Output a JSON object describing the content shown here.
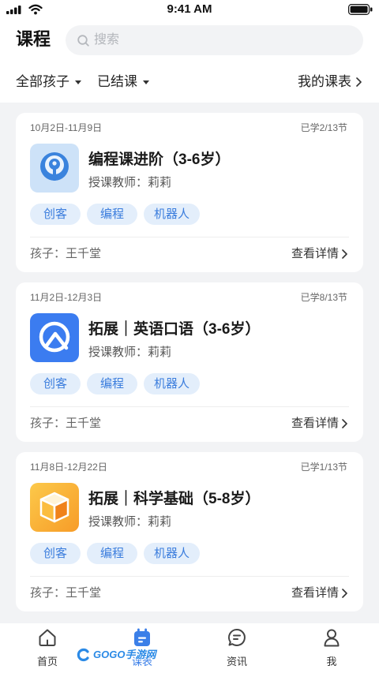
{
  "status_bar": {
    "time": "9:41 AM",
    "icons": [
      "signal-icon",
      "wifi-icon",
      "battery-icon"
    ]
  },
  "header": {
    "title": "课程",
    "search": {
      "placeholder": "搜索",
      "value": ""
    }
  },
  "filters": {
    "child": {
      "label": "全部孩子"
    },
    "status": {
      "label": "已结课"
    },
    "schedule_link": {
      "label": "我的课表"
    }
  },
  "courses": [
    {
      "date_range": "10月2日-11月9日",
      "progress": "已学2/13节",
      "icon": "coding-course-icon",
      "title": "编程课进阶（3-6岁）",
      "teacher": "授课教师：莉莉",
      "tags": [
        "创客",
        "编程",
        "机器人"
      ],
      "child": "孩子：王千堂",
      "detail_label": "查看详情"
    },
    {
      "date_range": "11月2日-12月3日",
      "progress": "已学8/13节",
      "icon": "english-course-icon",
      "title": "拓展｜英语口语（3-6岁）",
      "teacher": "授课教师：莉莉",
      "tags": [
        "创客",
        "编程",
        "机器人"
      ],
      "child": "孩子：王千堂",
      "detail_label": "查看详情"
    },
    {
      "date_range": "11月8日-12月22日",
      "progress": "已学1/13节",
      "icon": "science-course-icon",
      "title": "拓展｜科学基础（5-8岁）",
      "teacher": "授课教师：莉莉",
      "tags": [
        "创客",
        "编程",
        "机器人"
      ],
      "child": "孩子：王千堂",
      "detail_label": "查看详情"
    }
  ],
  "tab_bar": {
    "items": [
      {
        "label": "首页",
        "icon": "home-icon",
        "active": false
      },
      {
        "label": "课表",
        "icon": "calendar-icon",
        "active": true
      },
      {
        "label": "资讯",
        "icon": "chat-icon",
        "active": false
      },
      {
        "label": "我",
        "icon": "profile-icon",
        "active": false
      }
    ]
  },
  "watermark": {
    "text": "GOGO手游网"
  },
  "colors": {
    "accent": "#3b7fe8",
    "tag_bg": "#e3eefb",
    "tag_text": "#3b7ddd",
    "page_bg": "#f2f3f5"
  }
}
